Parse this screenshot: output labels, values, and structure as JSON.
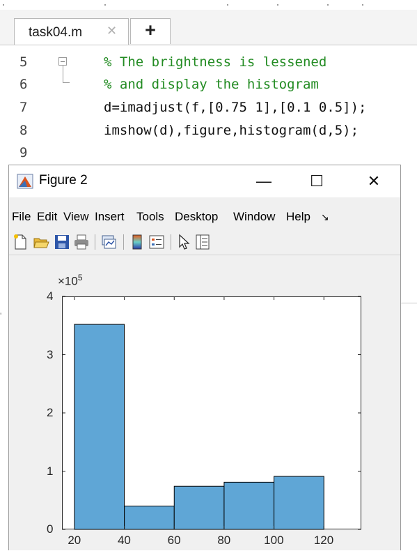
{
  "editor": {
    "tab_label": "task04.m",
    "tab_close_glyph": "✕",
    "tab_add_glyph": "+",
    "lines": [
      {
        "no": "5",
        "code": "% The brightness is lessened",
        "comment": true
      },
      {
        "no": "6",
        "code": "% and display the histogram",
        "comment": true
      },
      {
        "no": "7",
        "code": "d=imadjust(f,[0.75 1],[0.1 0.5]);",
        "comment": false
      },
      {
        "no": "8",
        "code": "imshow(d),figure,histogram(d,5);",
        "comment": false
      },
      {
        "no": "9",
        "code": "",
        "comment": false
      }
    ],
    "comment_color": "#228b22"
  },
  "figure": {
    "title": "Figure 2",
    "icon": "matlab-figure-icon",
    "window_buttons": {
      "minimize": "—",
      "maximize": "☐",
      "close": "✕"
    },
    "menu": [
      "File",
      "Edit",
      "View",
      "Insert",
      "Tools",
      "Desktop",
      "Window",
      "Help"
    ],
    "menu_overflow_glyph": "↘",
    "toolbar": [
      "new-figure-icon",
      "open-file-icon",
      "save-icon",
      "print-icon",
      "link-plot-icon",
      "colorbar-icon",
      "legend-icon",
      "pointer-arrow-icon",
      "property-inspector-icon"
    ]
  },
  "chart_data": {
    "type": "bar",
    "title": "",
    "xlabel": "",
    "ylabel": "",
    "bin_edges": [
      20,
      40,
      60,
      80,
      100,
      120
    ],
    "values": [
      352000,
      40000,
      74000,
      81000,
      91000
    ],
    "xlim": [
      15,
      135
    ],
    "ylim": [
      0,
      400000
    ],
    "xticks": [
      20,
      40,
      60,
      80,
      100,
      120
    ],
    "xtick_labels": [
      "20",
      "40",
      "60",
      "80",
      "100",
      "120"
    ],
    "yticks": [
      0,
      100000,
      200000,
      300000,
      400000
    ],
    "ytick_labels": [
      "0",
      "1",
      "2",
      "3",
      "4"
    ],
    "exponent_label": "×10",
    "exponent_power": "5",
    "bar_color": "#5fa6d6",
    "edge_color": "#000000",
    "grid": false
  }
}
